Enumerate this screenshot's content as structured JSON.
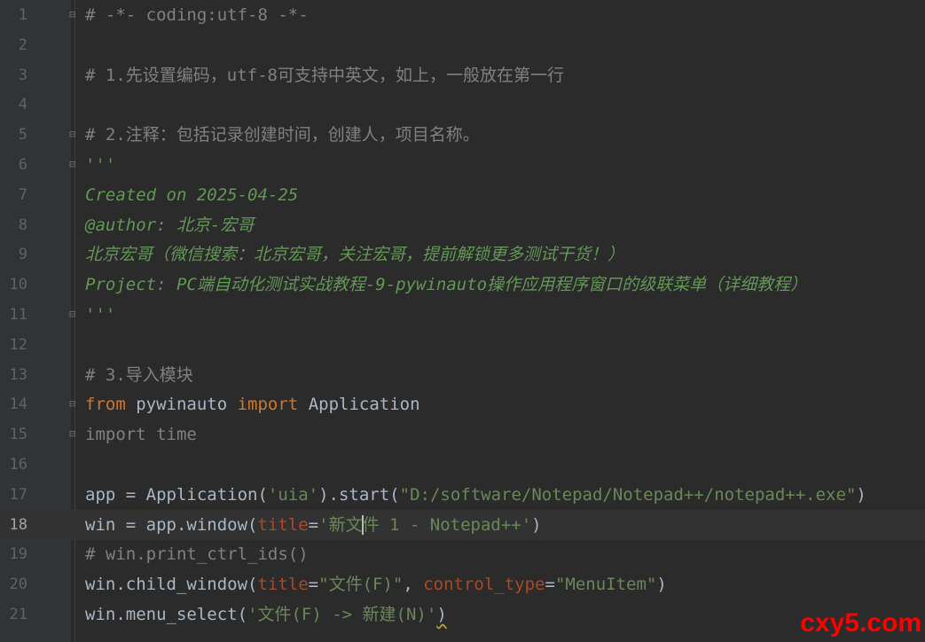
{
  "editor": {
    "current_line": 18,
    "lines": [
      {
        "n": "1",
        "parts": [
          {
            "t": "# -*- coding:utf-8 -*-",
            "c": "cm"
          }
        ]
      },
      {
        "n": "2",
        "parts": []
      },
      {
        "n": "3",
        "parts": [
          {
            "t": "# 1.先设置编码，utf-8可支持中英文，如上，一般放在第一行",
            "c": "cm"
          }
        ]
      },
      {
        "n": "4",
        "parts": []
      },
      {
        "n": "5",
        "parts": [
          {
            "t": "# 2.注释：包括记录创建时间，创建人，项目名称。",
            "c": "cm"
          }
        ]
      },
      {
        "n": "6",
        "parts": [
          {
            "t": "'''",
            "c": "doc"
          }
        ]
      },
      {
        "n": "7",
        "parts": [
          {
            "t": "Created on 2025-04-25",
            "c": "doc"
          }
        ]
      },
      {
        "n": "8",
        "parts": [
          {
            "t": "@author: 北京-宏哥",
            "c": "doc"
          }
        ]
      },
      {
        "n": "9",
        "parts": [
          {
            "t": "北京宏哥（微信搜索：北京宏哥，关注宏哥，提前解锁更多测试干货！）",
            "c": "doc"
          }
        ]
      },
      {
        "n": "10",
        "parts": [
          {
            "t": "Project: PC端自动化测试实战教程-9-pywinauto操作应用程序窗口的级联菜单（详细教程）",
            "c": "doc"
          }
        ]
      },
      {
        "n": "11",
        "parts": [
          {
            "t": "'''",
            "c": "doc"
          }
        ]
      },
      {
        "n": "12",
        "parts": []
      },
      {
        "n": "13",
        "parts": [
          {
            "t": "# 3.导入模块",
            "c": "cm"
          }
        ]
      },
      {
        "n": "14",
        "parts": [
          {
            "t": "from",
            "c": "kw"
          },
          {
            "t": " pywinauto ",
            "c": ""
          },
          {
            "t": "import",
            "c": "kw"
          },
          {
            "t": " Application",
            "c": ""
          }
        ]
      },
      {
        "n": "15",
        "parts": [
          {
            "t": "import time",
            "c": "cm"
          }
        ]
      },
      {
        "n": "16",
        "parts": []
      },
      {
        "n": "17",
        "parts": [
          {
            "t": "app = Application(",
            "c": ""
          },
          {
            "t": "'uia'",
            "c": "str"
          },
          {
            "t": ").start(",
            "c": ""
          },
          {
            "t": "\"D:/software/Notepad/Notepad++/notepad++.exe\"",
            "c": "str"
          },
          {
            "t": ")",
            "c": ""
          }
        ]
      },
      {
        "n": "18",
        "parts": [
          {
            "t": "win = app.window(",
            "c": ""
          },
          {
            "t": "title",
            "c": "param"
          },
          {
            "t": "=",
            "c": ""
          },
          {
            "t": "'新文",
            "c": "str"
          },
          {
            "t": "",
            "c": "caret"
          },
          {
            "t": "件 1 - Notepad++'",
            "c": "str"
          },
          {
            "t": ")",
            "c": ""
          }
        ]
      },
      {
        "n": "19",
        "parts": [
          {
            "t": "# win.print_ctrl_ids()",
            "c": "cm"
          }
        ]
      },
      {
        "n": "20",
        "parts": [
          {
            "t": "win.child_window(",
            "c": ""
          },
          {
            "t": "title",
            "c": "param"
          },
          {
            "t": "=",
            "c": ""
          },
          {
            "t": "\"文件(F)\"",
            "c": "str"
          },
          {
            "t": ", ",
            "c": ""
          },
          {
            "t": "control_type",
            "c": "param"
          },
          {
            "t": "=",
            "c": ""
          },
          {
            "t": "\"MenuItem\"",
            "c": "str"
          },
          {
            "t": ")",
            "c": ""
          }
        ]
      },
      {
        "n": "21",
        "parts": [
          {
            "t": "win.menu_select(",
            "c": ""
          },
          {
            "t": "'文件(F) -> 新建(N)'",
            "c": "str"
          },
          {
            "t": ")",
            "c": "squiggle"
          }
        ]
      }
    ]
  },
  "watermark": "cxy5.com",
  "colors": {
    "background": "#2b2b2b",
    "comment": "#808080",
    "docstring": "#629755",
    "keyword": "#cc7832",
    "string": "#6a8759",
    "parameter": "#aa4926",
    "default": "#a9b7c6",
    "watermark": "#ff0000"
  }
}
